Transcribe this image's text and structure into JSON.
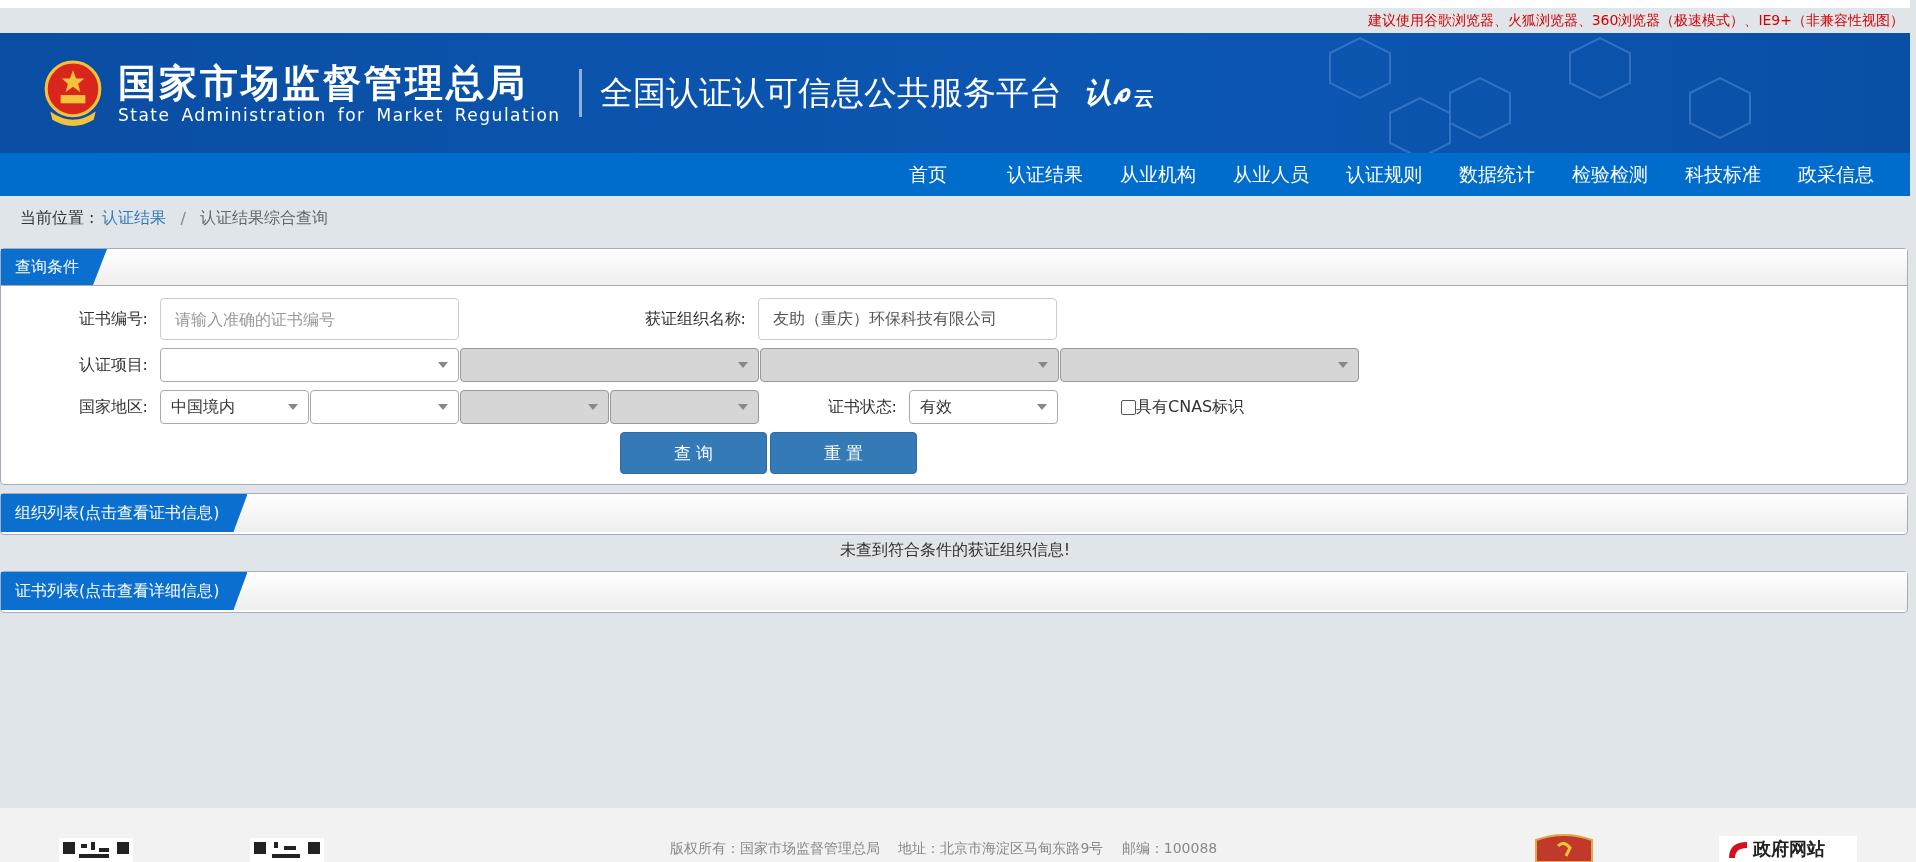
{
  "browser_notice": "建议使用谷歌浏览器、火狐浏览器、360浏览器（极速模式）、IE9+（非兼容性视图）",
  "header": {
    "agency_cn": "国家市场监督管理总局",
    "agency_en": "State Administration  for  Market Regulation",
    "platform_title": "全国认证认可信息公共服务平台",
    "platform_logo": {
      "left": "认",
      "right": "云"
    }
  },
  "nav": [
    "首页",
    "认证结果",
    "从业机构",
    "从业人员",
    "认证规则",
    "数据统计",
    "检验检测",
    "科技标准",
    "政采信息"
  ],
  "breadcrumb": {
    "prefix": "当前位置 :",
    "link": "认证结果",
    "separator": "/",
    "current": "认证结果综合查询"
  },
  "query_panel": {
    "title": "查询条件",
    "cert_no": {
      "label": "证书编号:",
      "placeholder": "请输入准确的证书编号"
    },
    "org_name": {
      "label": "获证组织名称:",
      "value": "友助（重庆）环保科技有限公司"
    },
    "project": {
      "label": "认证项目:",
      "selects": [
        {
          "disabled": false
        },
        {
          "disabled": true
        },
        {
          "disabled": true
        },
        {
          "disabled": true
        }
      ]
    },
    "region": {
      "label": "国家地区:",
      "selects": [
        {
          "value": "中国境内",
          "disabled": false
        },
        {
          "disabled": false
        },
        {
          "disabled": true
        },
        {
          "disabled": true
        }
      ]
    },
    "status": {
      "label": "证书状态:",
      "value": "有效"
    },
    "cnas": {
      "label": "具有CNAS标识",
      "checked": false
    },
    "buttons": [
      "查 询",
      "重 置"
    ]
  },
  "org_panel": {
    "title": "组织列表(点击查看证书信息)",
    "message": "未查到符合条件的获证组织信息!"
  },
  "cert_panel": {
    "title": "证书列表(点击查看详细信息)"
  },
  "footer": {
    "text": "版权所有：国家市场监督管理总局　 地址：北京市海淀区马甸东路9号　 邮编：100088",
    "gov_logo": "政府网站"
  }
}
